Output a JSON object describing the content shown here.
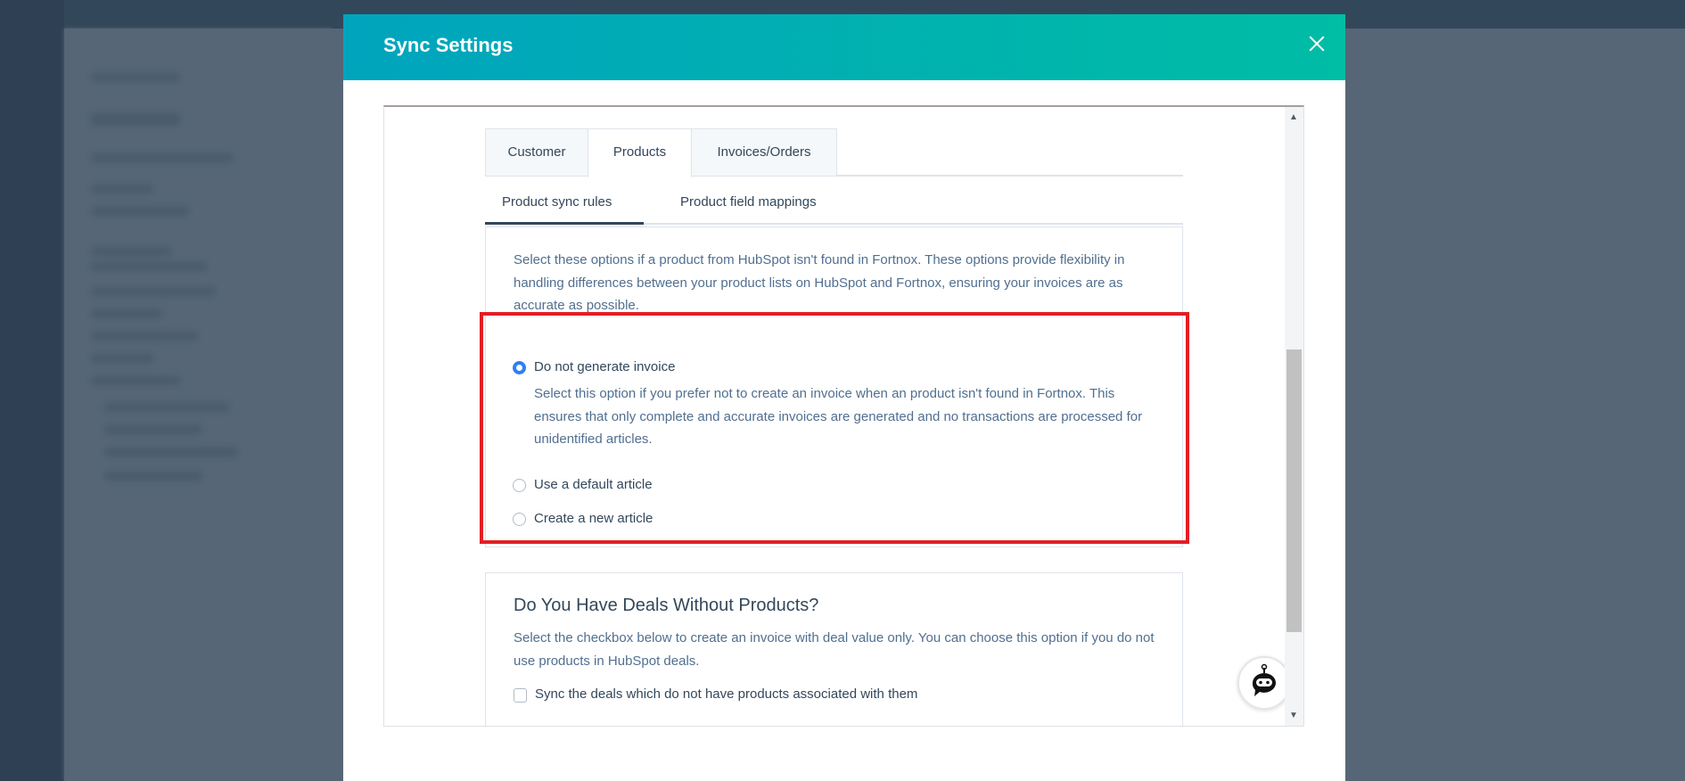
{
  "modal": {
    "title": "Sync Settings",
    "close_icon": "close-icon"
  },
  "tabs": [
    {
      "label": "Customer"
    },
    {
      "label": "Products",
      "active": true
    },
    {
      "label": "Invoices/Orders"
    }
  ],
  "subtabs": [
    {
      "label": "Product sync rules",
      "active": true
    },
    {
      "label": "Product field mappings"
    }
  ],
  "missing_product": {
    "intro": "Select these options if a product from HubSpot isn't found in Fortnox. These options provide flexibility in handling differences between your product lists on HubSpot and Fortnox, ensuring your invoices are as accurate as possible.",
    "options": [
      {
        "label": "Do not generate invoice",
        "selected": true,
        "description": "Select this option if you prefer not to create an invoice when an product isn't found in Fortnox. This ensures that only complete and accurate invoices are generated and no transactions are processed for unidentified articles."
      },
      {
        "label": "Use a default article",
        "selected": false
      },
      {
        "label": "Create a new article",
        "selected": false
      }
    ],
    "highlight_color": "#e31e24"
  },
  "deals_section": {
    "heading": "Do You Have Deals Without Products?",
    "description": "Select the checkbox below to create an invoice with deal value only. You can choose this option if you do not use products in HubSpot deals.",
    "checkbox_label": "Sync the deals which do not have products associated with them",
    "checked": false
  },
  "chatbot": {
    "icon": "chatbot-robot-icon"
  },
  "colors": {
    "header_start": "#00a4bd",
    "header_end": "#00bda5",
    "radio_selected": "#2d7ff9"
  }
}
